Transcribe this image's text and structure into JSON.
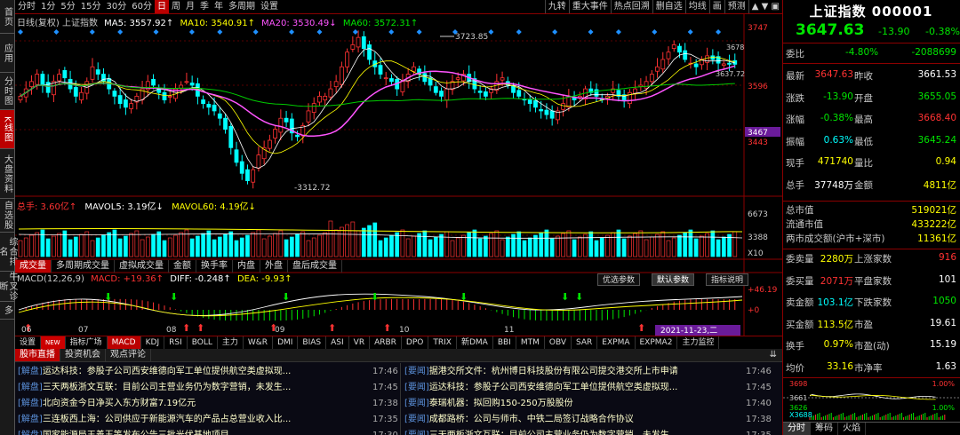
{
  "left_tabs": [
    "首页",
    "应用",
    "分时图",
    "K线图",
    "大盘资料",
    "自选股",
    "综合排名",
    "牛叉诊断",
    "多"
  ],
  "left_tab_active": 3,
  "topbar": {
    "left": [
      "分时",
      "1分",
      "5分",
      "15分",
      "30分",
      "60分",
      "日",
      "周",
      "月",
      "季",
      "年",
      "多周期",
      "设置"
    ],
    "selected": "日",
    "right": [
      "九转",
      "重大事件",
      "热点回溯",
      "删自选",
      "均线",
      "画",
      "预测"
    ]
  },
  "kline": {
    "title": "日线(复权) 上证指数",
    "ma5": "MA5: 3557.92↑",
    "ma10": "MA10: 3540.91↑",
    "ma20": "MA20: 3530.49↓",
    "ma60": "MA60: 3572.31↑",
    "price_labels": [
      "3747",
      "3596",
      "3467",
      "3443"
    ],
    "high_label": "3723.85",
    "low_label": "3312.72",
    "recent_label": "3678",
    "recent_label2": "3637.72"
  },
  "volume": {
    "total": "总手: 3.60亿↑",
    "mavol5": "MAVOL5: 3.19亿↓",
    "mavol60": "MAVOL60: 4.19亿↓",
    "labels": [
      "6673",
      "3388",
      "X10"
    ]
  },
  "vol_tabs": [
    "成交量",
    "多周期成交量",
    "虚拟成交量",
    "金额",
    "换手率",
    "内盘",
    "外盘",
    "盘后成交量"
  ],
  "vol_tab_sel": "成交量",
  "macd": {
    "title": "MACD(12,26,9)",
    "macd": "MACD: +19.36↑",
    "diff": "DIFF: -0.248↑",
    "dea": "DEA: -9.93↑",
    "labels": [
      "+46.19",
      "+0"
    ],
    "buttons": [
      "优选参数",
      "默认参数",
      "指标说明"
    ],
    "btn_sel": "默认参数"
  },
  "months": [
    "06",
    "07",
    "08",
    "09",
    "10",
    "11"
  ],
  "date_cursor": "2021-11-23,二",
  "ind_tabs": [
    "设置",
    "NEW",
    "指标广场",
    "MACD",
    "KDJ",
    "RSI",
    "BOLL",
    "主力",
    "W&R",
    "DMI",
    "BIAS",
    "ASI",
    "VR",
    "ARBR",
    "DPO",
    "TRIX",
    "新DMA",
    "BBI",
    "MTM",
    "OBV",
    "SAR",
    "EXPMA",
    "EXPMA2",
    "主力监控"
  ],
  "ind_sel": "MACD",
  "news_tabs": [
    "股市直播",
    "投资机会",
    "观点评论"
  ],
  "news_left": [
    {
      "tag": "[解盘]",
      "text": "运达科技：参股子公司西安维德向军工单位提供航空类虚拟现...",
      "time": "17:46"
    },
    {
      "tag": "[解盘]",
      "text": "三天两板浙文互联：目前公司主营业务仍为数字营销，未发生...",
      "time": "17:45"
    },
    {
      "tag": "[解盘]",
      "text": "北向资金今日净买入东方财富7.19亿元",
      "time": "17:38"
    },
    {
      "tag": "[解盘]",
      "text": "三连板西上海：公司供应于新能源汽车的产品占总营业收入比...",
      "time": "17:35"
    },
    {
      "tag": "[解盘]",
      "text": "国家能源局王善玉等发布公告三批光伏基地项目",
      "time": "17:30"
    }
  ],
  "news_right": [
    {
      "tag": "[要闻]",
      "text": "据港交所文件：杭州博日科技股份有限公司提交港交所上市申请",
      "time": "17:46"
    },
    {
      "tag": "[要闻]",
      "text": "运达科技：参股子公司西安维德向军工单位提供航空类虚拟现...",
      "time": "17:45"
    },
    {
      "tag": "[要闻]",
      "text": "泰瑞机器：拟回购150-250万股股份",
      "time": "17:40"
    },
    {
      "tag": "[要闻]",
      "text": "成都路桥：公司与师市、中铁二局签订战略合作协议",
      "time": "17:38"
    },
    {
      "tag": "[要闻]",
      "text": "三天两板浙文互联：目前公司主营业务仍为数字营销，未发生...",
      "time": "17:35"
    }
  ],
  "quote": {
    "name": "上证指数 000001",
    "price": "3647.63",
    "change": "-13.90",
    "pct": "-0.38%",
    "weibi_label": "委比",
    "weibi": "-4.80%",
    "weicha": "-2088699",
    "rows": [
      {
        "l1": "最新",
        "v1": "3647.63",
        "c1": "red",
        "l2": "昨收",
        "v2": "3661.53",
        "c2": "wht"
      },
      {
        "l1": "涨跌",
        "v1": "-13.90",
        "c1": "grn",
        "l2": "开盘",
        "v2": "3655.05",
        "c2": "grn"
      },
      {
        "l1": "涨幅",
        "v1": "-0.38%",
        "c1": "grn",
        "l2": "最高",
        "v2": "3668.40",
        "c2": "red"
      },
      {
        "l1": "振幅",
        "v1": "0.63%",
        "c1": "cyn",
        "l2": "最低",
        "v2": "3645.24",
        "c2": "grn"
      },
      {
        "l1": "现手",
        "v1": "471740",
        "c1": "yel",
        "l2": "量比",
        "v2": "0.94",
        "c2": "yel"
      },
      {
        "l1": "总手",
        "v1": "37748万",
        "c1": "wht",
        "l2": "金额",
        "v2": "4811亿",
        "c2": "yel"
      }
    ],
    "mkt": [
      {
        "l": "总市值",
        "v": "519021亿"
      },
      {
        "l": "流通市值",
        "v": "433222亿"
      },
      {
        "l": "两市成交额(沪市+深市)",
        "v": "11361亿"
      }
    ],
    "rows2": [
      {
        "l1": "委卖量",
        "v1": "2280万",
        "c1": "yel",
        "l2": "上涨家数",
        "v2": "916",
        "c2": "red"
      },
      {
        "l1": "委买量",
        "v1": "2071万",
        "c1": "red",
        "l2": "平盘家数",
        "v2": "101",
        "c2": "wht"
      },
      {
        "l1": "卖金额",
        "v1": "103.1亿",
        "c1": "cyn",
        "l2": "下跌家数",
        "v2": "1050",
        "c2": "grn"
      },
      {
        "l1": "买金额",
        "v1": "113.5亿",
        "c1": "yel",
        "l2": "市盈",
        "v2": "19.61",
        "c2": "wht"
      },
      {
        "l1": "换手",
        "v1": "0.97%",
        "c1": "yel",
        "l2": "市盈(动)",
        "v2": "15.19",
        "c2": "wht"
      },
      {
        "l1": "均价",
        "v1": "33.16",
        "c1": "yel",
        "l2": "市净率",
        "v2": "1.63",
        "c2": "wht"
      }
    ],
    "mini": {
      "top": "3698",
      "top_pct": "1.00%",
      "mid": "3661",
      "bot": "3626",
      "bot_pct": "1.00%",
      "vol": "X3688"
    },
    "bottom_tabs": [
      "分时",
      "筹码",
      "火焰"
    ],
    "bottom_sel": "分时"
  },
  "colors": {
    "up": "#ff3232",
    "down": "#00ffff",
    "ma5": "#ffffff",
    "ma10": "#ffff00",
    "ma20": "#ff55ff",
    "ma60": "#00cc00"
  }
}
